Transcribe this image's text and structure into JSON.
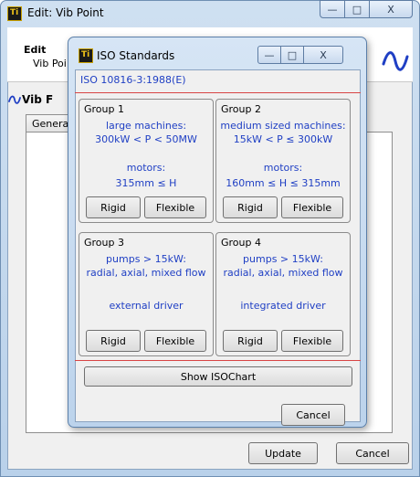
{
  "outer_window": {
    "title": "Edit: Vib Point",
    "header_title": "Edit",
    "header_sub": "Vib Poi",
    "vib_label": "Vib F",
    "tab_general": "Genera",
    "update_label": "Update",
    "cancel_label": "Cancel",
    "caption": {
      "minimize": "—",
      "maximize": "□",
      "close": "X"
    }
  },
  "iso_dialog": {
    "title": "ISO Standards",
    "standard": "ISO 10816-3:1988(E)",
    "caption": {
      "minimize": "—",
      "maximize": "□",
      "close": "X"
    },
    "groups": [
      {
        "title": "Group 1",
        "line1": "large machines:",
        "line2": "300kW < P < 50MW",
        "line3": "motors:",
        "line4": "315mm ≤ H",
        "rigid": "Rigid",
        "flexible": "Flexible"
      },
      {
        "title": "Group 2",
        "line1": "medium sized machines:",
        "line2": "15kW < P ≤ 300kW",
        "line3": "motors:",
        "line4": "160mm ≤ H ≤ 315mm",
        "rigid": "Rigid",
        "flexible": "Flexible"
      },
      {
        "title": "Group 3",
        "line1": "pumps > 15kW:",
        "line2": "radial, axial, mixed flow",
        "line3": "external driver",
        "line4": "",
        "rigid": "Rigid",
        "flexible": "Flexible"
      },
      {
        "title": "Group 4",
        "line1": "pumps > 15kW:",
        "line2": "radial, axial, mixed flow",
        "line3": "integrated driver",
        "line4": "",
        "rigid": "Rigid",
        "flexible": "Flexible"
      }
    ],
    "show_chart_label": "Show ISOChart",
    "cancel_label": "Cancel"
  },
  "colors": {
    "link_text": "#1f3fc4",
    "separator": "#d84545",
    "wave": "#1f3fc4"
  },
  "icons": {
    "app": "app-logo-icon",
    "wave": "wave-icon"
  }
}
